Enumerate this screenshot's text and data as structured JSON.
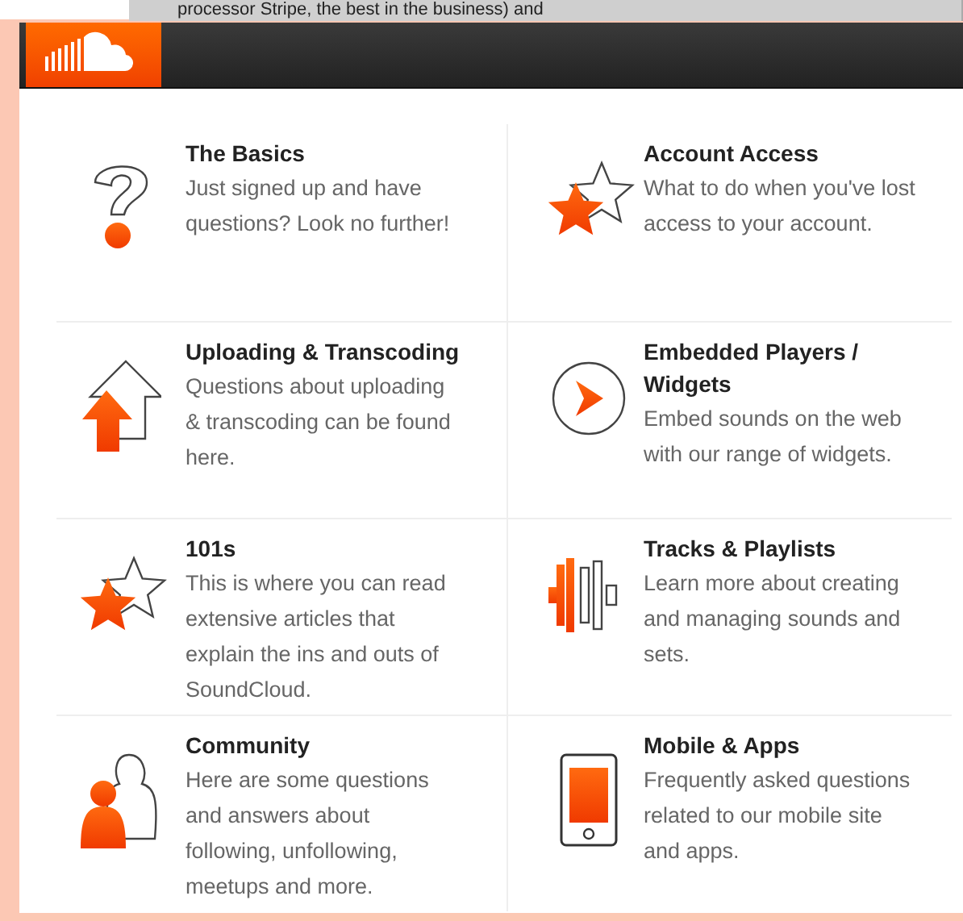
{
  "background_text": "processor Stripe, the best in the business) and",
  "topics": [
    {
      "title": "The Basics",
      "description": "Just signed up and have questions? Look no further!"
    },
    {
      "title": "Account Access",
      "description": "What to do when you've lost access to your account."
    },
    {
      "title": "Uploading & Transcoding",
      "description": "Questions about uploading & transcoding can be found here."
    },
    {
      "title": "Embedded Players / Widgets",
      "description": "Embed sounds on the web with our range of widgets."
    },
    {
      "title": "101s",
      "description": "This is where you can read extensive articles that explain the ins and outs of SoundCloud."
    },
    {
      "title": "Tracks & Playlists",
      "description": "Learn more about creating and managing sounds and sets."
    },
    {
      "title": "Community",
      "description": "Here are some questions and answers about following, unfollowing, meetups and more."
    },
    {
      "title": "Mobile & Apps",
      "description": "Frequently asked questions related to our mobile site and apps."
    }
  ]
}
